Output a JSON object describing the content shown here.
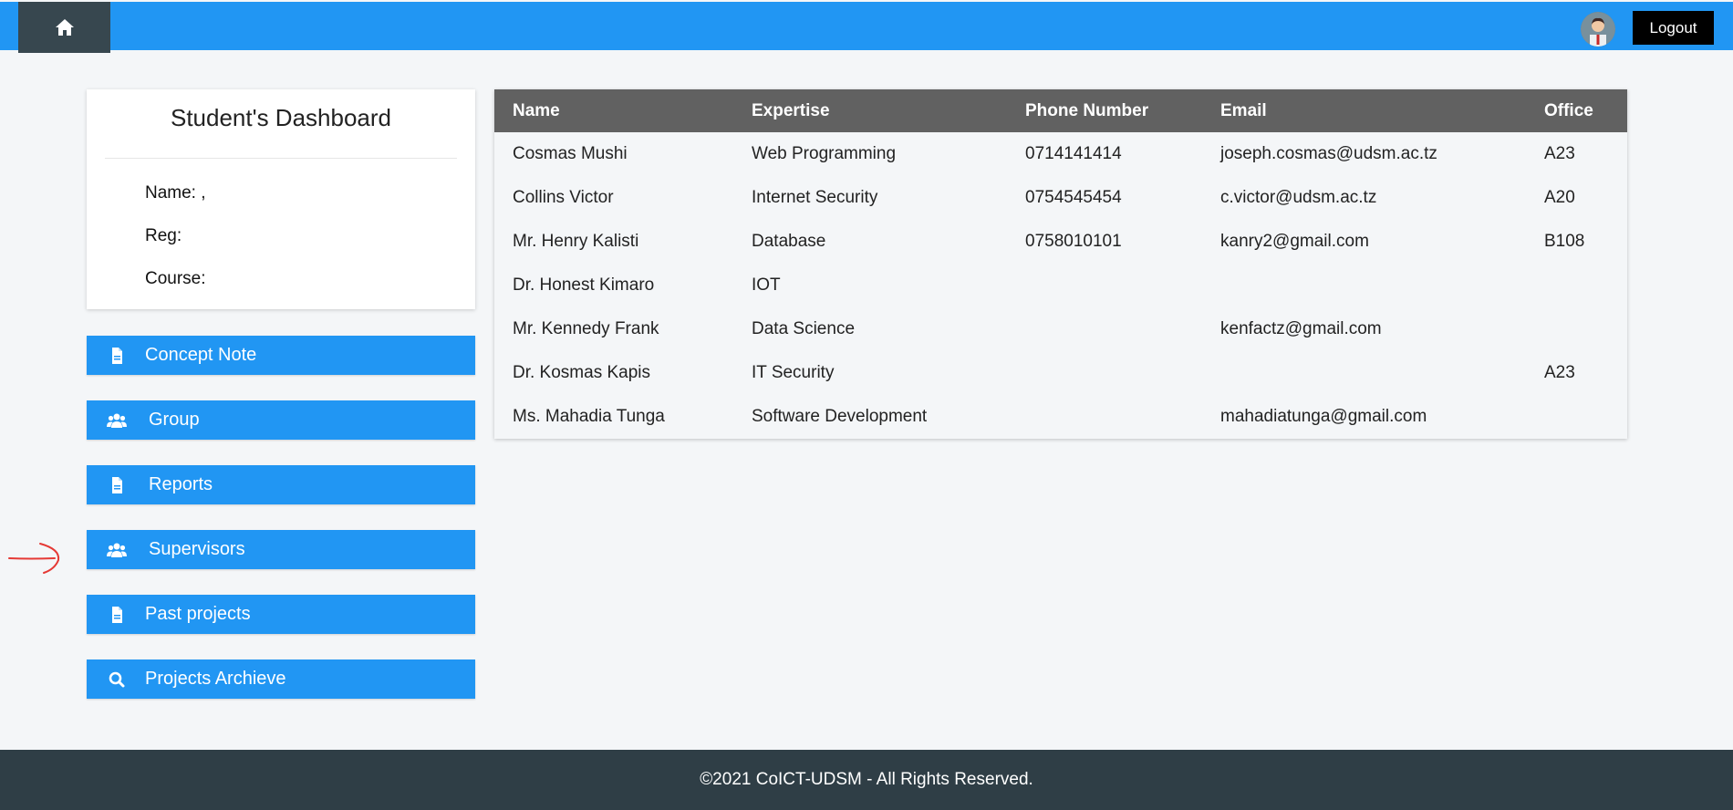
{
  "topbar": {
    "logout_label": "Logout"
  },
  "card": {
    "title": "Student's Dashboard",
    "name_label": "Name: ,",
    "reg_label": "Reg:",
    "course_label": "Course:"
  },
  "menu": {
    "items": [
      {
        "label": "Concept Note",
        "icon": "file-icon"
      },
      {
        "label": "Group",
        "icon": "users-icon"
      },
      {
        "label": "Reports",
        "icon": "file-icon"
      },
      {
        "label": "Supervisors",
        "icon": "users-icon"
      },
      {
        "label": "Past projects",
        "icon": "file-icon"
      },
      {
        "label": "Projects Archieve",
        "icon": "search-icon"
      }
    ]
  },
  "table": {
    "headers": [
      "Name",
      "Expertise",
      "Phone Number",
      "Email",
      "Office"
    ],
    "rows": [
      [
        "Cosmas Mushi",
        "Web Programming",
        "0714141414",
        "joseph.cosmas@udsm.ac.tz",
        "A23"
      ],
      [
        "Collins Victor",
        "Internet Security",
        "0754545454",
        "c.victor@udsm.ac.tz",
        "A20"
      ],
      [
        "Mr. Henry Kalisti",
        "Database",
        "0758010101",
        "kanry2@gmail.com",
        "B108"
      ],
      [
        "Dr. Honest Kimaro",
        "IOT",
        "",
        "",
        ""
      ],
      [
        "Mr. Kennedy Frank",
        "Data Science",
        "",
        "kenfactz@gmail.com",
        ""
      ],
      [
        "Dr. Kosmas Kapis",
        "IT Security",
        "",
        "",
        "A23"
      ],
      [
        "Ms. Mahadia Tunga",
        "Software Development",
        "",
        "mahadiatunga@gmail.com",
        ""
      ]
    ]
  },
  "footer": {
    "text": "©2021 CoICT-UDSM - All Rights Reserved."
  },
  "colors": {
    "primary": "#2196f3",
    "dark": "#37474f",
    "table_header": "#616161",
    "footer": "#2f3e46",
    "annotation": "#e53935"
  }
}
